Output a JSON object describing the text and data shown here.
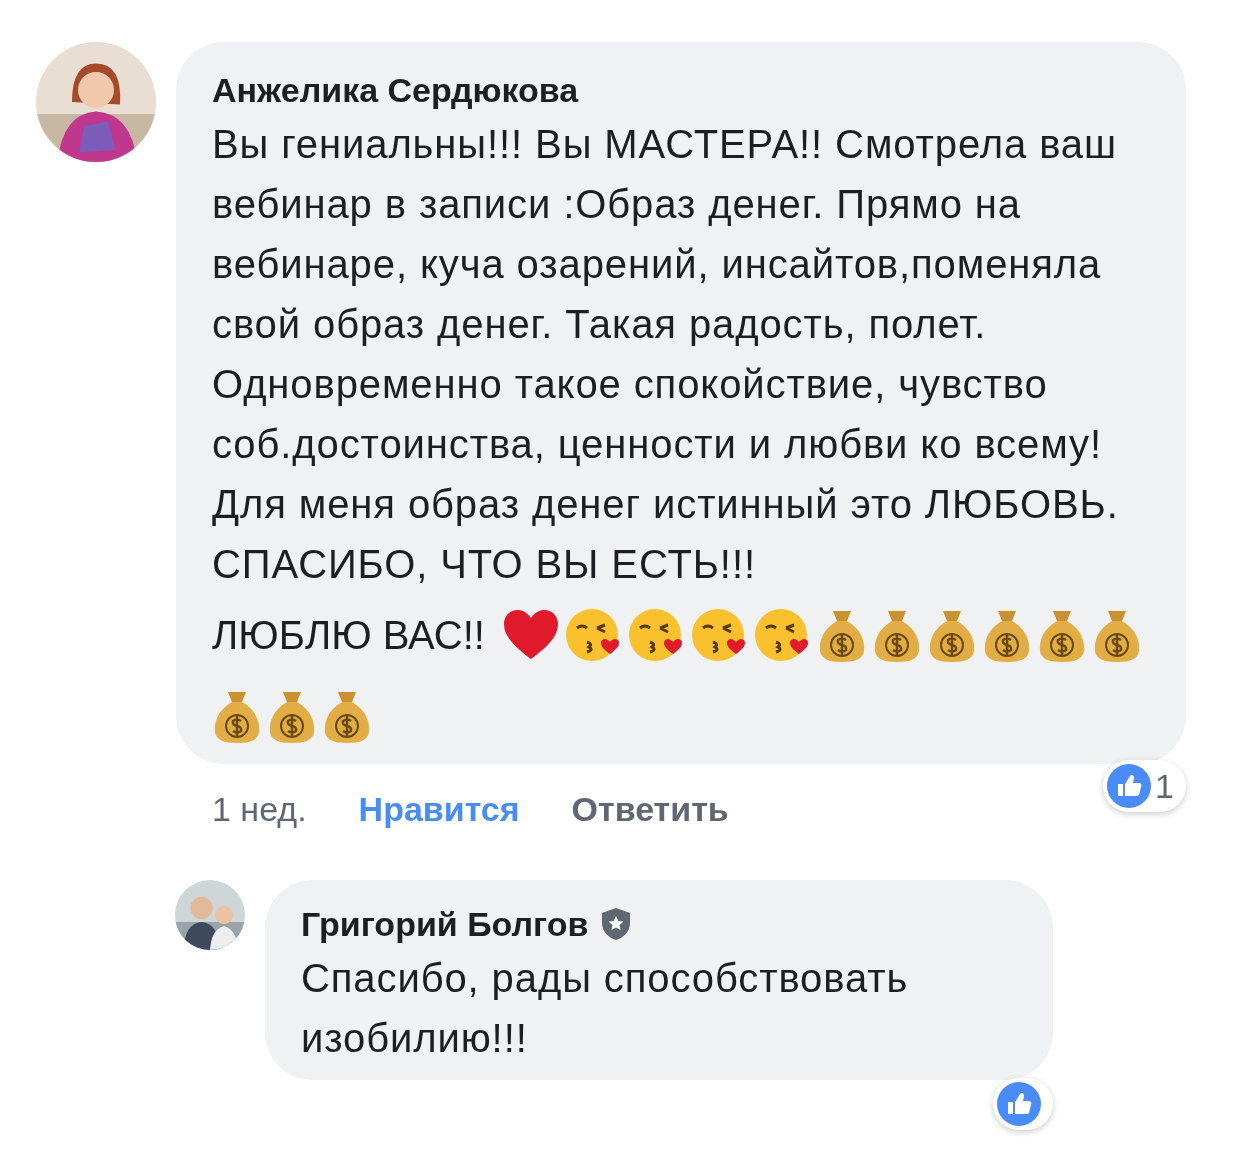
{
  "comment": {
    "author": "Анжелика Сердюкова",
    "text": "Вы гениальны!!! Вы МАСТЕРА!! Смотрела ваш вебинар в записи :Образ денег. Прямо на вебинаре, куча  озарений, инсайтов,поменяла свой образ денег. Такая радость, полет. Одновременно такое спокойствие, чувство соб.достоинства, ценности и любви ко всему! Для меня образ денег истинный это ЛЮБОВЬ. СПАСИБО, ЧТО ВЫ ЕСТЬ!!!",
    "last_line": "ЛЮБЛЮ ВАС!!",
    "emojis": [
      {
        "kind": "heart"
      },
      {
        "kind": "kiss"
      },
      {
        "kind": "kiss"
      },
      {
        "kind": "kiss"
      },
      {
        "kind": "kiss"
      },
      {
        "kind": "money"
      },
      {
        "kind": "money"
      },
      {
        "kind": "money"
      },
      {
        "kind": "money"
      },
      {
        "kind": "money"
      },
      {
        "kind": "money"
      },
      {
        "kind": "money"
      },
      {
        "kind": "money"
      },
      {
        "kind": "money"
      }
    ],
    "time": "1 нед.",
    "like_label": "Нравится",
    "liked": true,
    "reply_label": "Ответить",
    "reaction_count": "1"
  },
  "reply": {
    "author": "Григорий Болгов",
    "moderator": true,
    "text": "Спасибо, рады способствовать изобилию!!!"
  }
}
